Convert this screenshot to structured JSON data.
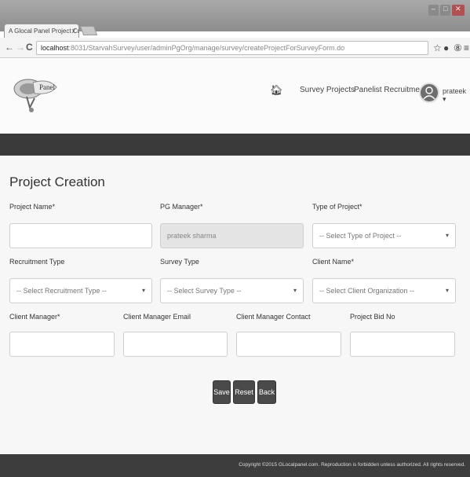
{
  "browser": {
    "tab_title": "A Glocal Panel Project Cre",
    "tab_close": "x",
    "url_host": "localhost",
    "url_path": ":8031/StarvahSurvey/user/adminPgOrg/manage/survey/createProjectForSurveyForm.do"
  },
  "header": {
    "logo_text": "Panel",
    "nav": {
      "survey_projects": "Survey Projects",
      "panelist_recruitment": "Panelist Recruitment"
    },
    "username": "prateek ▾"
  },
  "form": {
    "title": "Project Creation",
    "fields": {
      "project_name": {
        "label": "Project Name*",
        "value": ""
      },
      "pg_manager": {
        "label": "PG Manager*",
        "value": "prateek sharma"
      },
      "type_of_project": {
        "label": "Type of Project*",
        "value": "-- Select Type of Project --"
      },
      "recruitment_type": {
        "label": "Recruitment Type",
        "value": "-- Select Recruitment Type --"
      },
      "survey_type": {
        "label": "Survey Type",
        "value": "-- Select Survey Type --"
      },
      "client_name": {
        "label": "Client Name*",
        "value": "-- Select Client Organization --"
      },
      "client_manager": {
        "label": "Client Manager*",
        "value": ""
      },
      "client_manager_email": {
        "label": "Client Manager Email",
        "value": ""
      },
      "client_manager_contact": {
        "label": "Client Manager Contact",
        "value": ""
      },
      "project_bid_no": {
        "label": "Project Bid No",
        "value": ""
      }
    },
    "buttons": {
      "save": "Save",
      "reset": "Reset",
      "back": "Back"
    }
  },
  "footer": {
    "copyright": "Copyright ©2015 GLocalpanel.com. Reproduction is forbidden unless authorized. All rights reserved."
  }
}
